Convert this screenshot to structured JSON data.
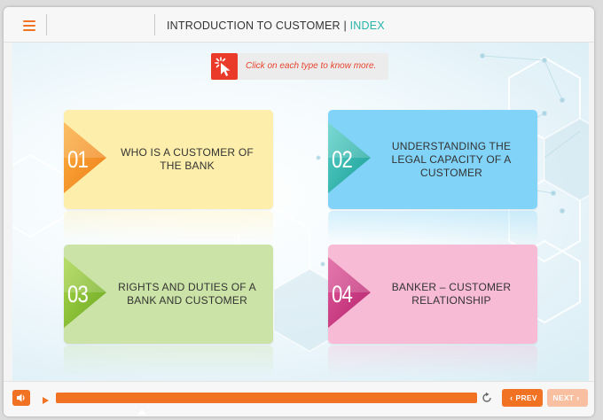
{
  "header": {
    "title_main": "INTRODUCTION TO CUSTOMER",
    "title_separator": "|",
    "title_accent": "INDEX"
  },
  "hint": {
    "text": "Click on each type to know more.",
    "icon": "pointer-click-icon"
  },
  "cards": [
    {
      "number": "01",
      "label": "WHO IS A CUSTOMER OF THE BANK"
    },
    {
      "number": "02",
      "label": "UNDERSTANDING THE LEGAL CAPACITY OF A CUSTOMER"
    },
    {
      "number": "03",
      "label": "RIGHTS AND DUTIES OF A BANK AND CUSTOMER"
    },
    {
      "number": "04",
      "label": "BANKER – CUSTOMER RELATIONSHIP"
    }
  ],
  "player": {
    "progress_percent": 100,
    "prev_label": "PREV",
    "next_label": "NEXT",
    "icons": [
      "menu-icon",
      "volume-icon",
      "play-icon",
      "replay-icon"
    ]
  },
  "colors": {
    "accent": "#f07222",
    "title_accent": "#26b5a8",
    "hint": "#e8432d",
    "card1": "#fdeeab",
    "card2": "#81d3f8",
    "card3": "#cbe3a6",
    "card4": "#f8bbd5"
  }
}
